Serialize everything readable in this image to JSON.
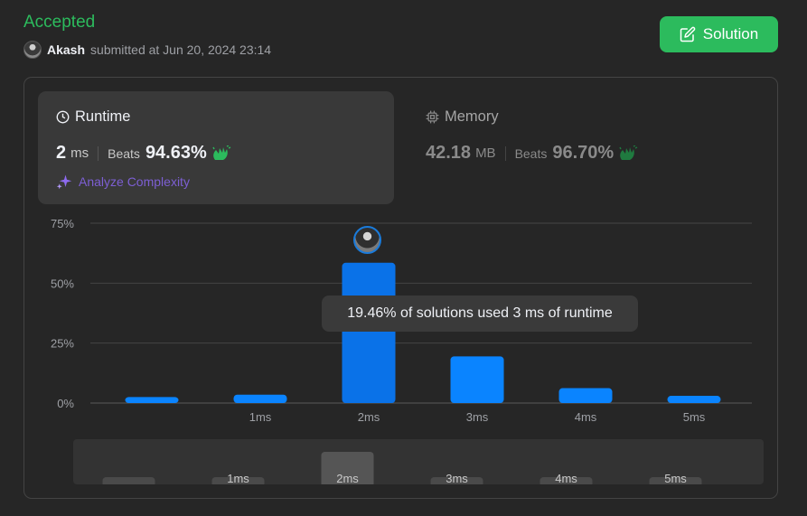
{
  "status": "Accepted",
  "submission": {
    "user": "Akash",
    "submitted_text": "submitted at Jun 20, 2024 23:14"
  },
  "solution_button": {
    "label": "Solution",
    "icon": "edit-icon"
  },
  "runtime": {
    "title": "Runtime",
    "icon": "clock-icon",
    "value": "2",
    "unit": "ms",
    "beats_label": "Beats",
    "beats_pct": "94.63%",
    "analyze_label": "Analyze Complexity"
  },
  "memory": {
    "title": "Memory",
    "icon": "chip-icon",
    "value": "42.18",
    "unit": "MB",
    "beats_label": "Beats",
    "beats_pct": "96.70%"
  },
  "tooltip": "19.46% of solutions used 3 ms of runtime",
  "colors": {
    "accent_green": "#2cbb5d",
    "bar_blue": "#0a84ff",
    "purple": "#7d5fd4"
  },
  "chart_data": {
    "type": "bar",
    "y_ticks": [
      "75%",
      "50%",
      "25%",
      "0%"
    ],
    "ylim": [
      0,
      75
    ],
    "categories": [
      "",
      "1ms",
      "2ms",
      "3ms",
      "4ms",
      "5ms"
    ],
    "values": [
      2.5,
      3.5,
      58.5,
      19.46,
      6.2,
      3.0
    ],
    "highlighted_category": "2ms",
    "grid": true
  },
  "navigator": {
    "labels": [
      "",
      "1ms",
      "2ms",
      "3ms",
      "4ms",
      "5ms"
    ],
    "values": [
      2.5,
      3.5,
      58.5,
      19.46,
      6.2,
      3.0
    ],
    "selected_label": "2ms"
  }
}
